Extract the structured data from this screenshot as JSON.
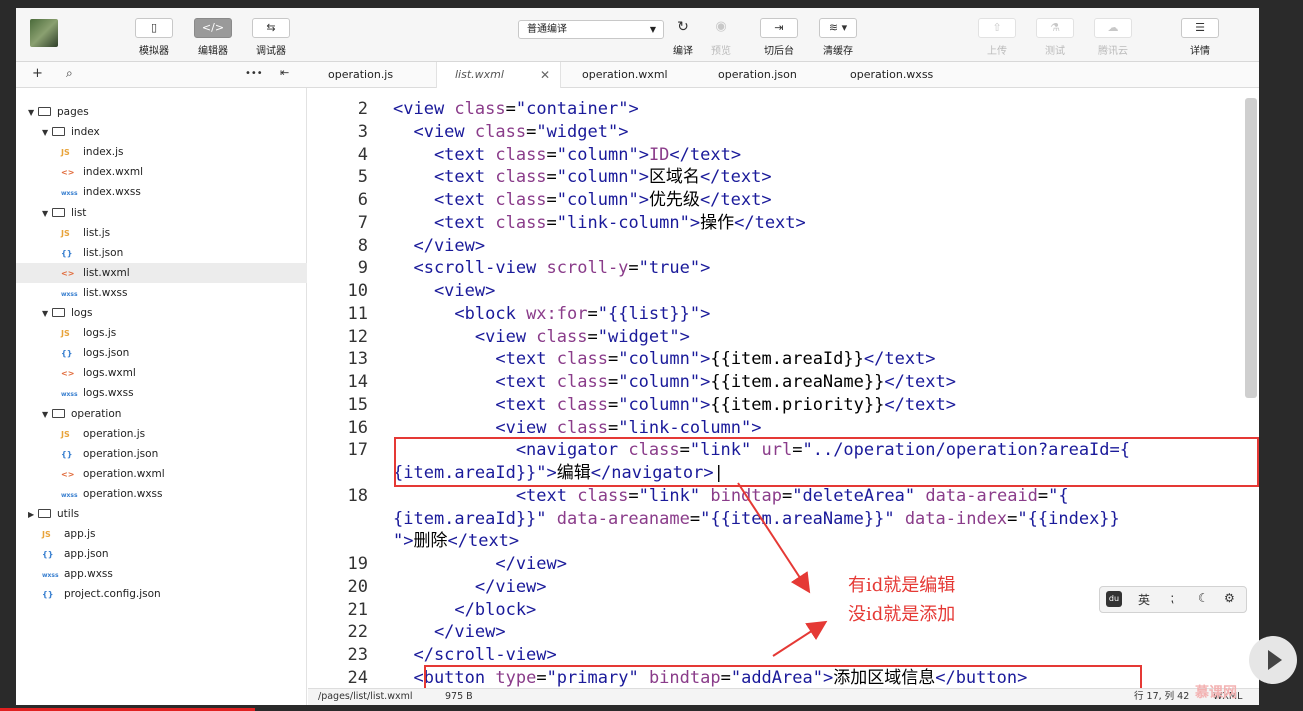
{
  "toolbar": {
    "simulator": "模拟器",
    "editor": "编辑器",
    "debugger": "调试器",
    "compile_mode": "普通编译",
    "compile": "编译",
    "preview": "预览",
    "background": "切后台",
    "clear_cache": "清缓存",
    "upload": "上传",
    "test": "测试",
    "tencent_cloud": "腾讯云",
    "details": "详情"
  },
  "tabs": [
    {
      "label": "operation.js"
    },
    {
      "label": "list.wxml"
    },
    {
      "label": "operation.wxml"
    },
    {
      "label": "operation.json"
    },
    {
      "label": "operation.wxss"
    }
  ],
  "tree": [
    {
      "label": "pages"
    },
    {
      "label": "index"
    },
    {
      "icon": "JS",
      "label": "index.js"
    },
    {
      "icon": "<>",
      "label": "index.wxml"
    },
    {
      "icon": "wxss",
      "label": "index.wxss"
    },
    {
      "label": "list"
    },
    {
      "icon": "JS",
      "label": "list.js"
    },
    {
      "icon": "{}",
      "label": "list.json"
    },
    {
      "icon": "<>",
      "label": "list.wxml"
    },
    {
      "icon": "wxss",
      "label": "list.wxss"
    },
    {
      "label": "logs"
    },
    {
      "icon": "JS",
      "label": "logs.js"
    },
    {
      "icon": "{}",
      "label": "logs.json"
    },
    {
      "icon": "<>",
      "label": "logs.wxml"
    },
    {
      "icon": "wxss",
      "label": "logs.wxss"
    },
    {
      "label": "operation"
    },
    {
      "icon": "JS",
      "label": "operation.js"
    },
    {
      "icon": "{}",
      "label": "operation.json"
    },
    {
      "icon": "<>",
      "label": "operation.wxml"
    },
    {
      "icon": "wxss",
      "label": "operation.wxss"
    },
    {
      "label": "utils"
    },
    {
      "icon": "JS",
      "label": "app.js"
    },
    {
      "icon": "{}",
      "label": "app.json"
    },
    {
      "icon": "wxss",
      "label": "app.wxss"
    },
    {
      "icon": "{}",
      "label": "project.config.json"
    }
  ],
  "code": {
    "numbers": [
      "2",
      "3",
      "4",
      "5",
      "6",
      "7",
      "8",
      "9",
      "10",
      "11",
      "12",
      "13",
      "14",
      "15",
      "16",
      "17",
      "18",
      "19",
      "20",
      "21",
      "22",
      "23",
      "24"
    ],
    "l2": [
      "<view ",
      "class",
      "=",
      "\"container\"",
      ">"
    ],
    "l3": [
      "  <view ",
      "class",
      "=",
      "\"widget\"",
      ">"
    ],
    "l4": [
      "    <text ",
      "class",
      "=",
      "\"column\"",
      ">",
      "ID",
      "</text>"
    ],
    "l5": [
      "    <text ",
      "class",
      "=",
      "\"column\"",
      ">",
      "区域名",
      "</text>"
    ],
    "l6": [
      "    <text ",
      "class",
      "=",
      "\"column\"",
      ">",
      "优先级",
      "</text>"
    ],
    "l7": [
      "    <text ",
      "class",
      "=",
      "\"link-column\"",
      ">",
      "操作",
      "</text>"
    ],
    "l8": [
      "  </view>"
    ],
    "l9": [
      "  <scroll-view ",
      "scroll-y",
      "=",
      "\"true\"",
      ">"
    ],
    "l10": [
      "    <view>"
    ],
    "l11": [
      "      <block ",
      "wx:for",
      "=",
      "\"{{list}}\"",
      ">"
    ],
    "l12": [
      "        <view ",
      "class",
      "=",
      "\"widget\"",
      ">"
    ],
    "l13": [
      "          <text ",
      "class",
      "=",
      "\"column\"",
      ">",
      "{{item.areaId}}",
      "</text>"
    ],
    "l14": [
      "          <text ",
      "class",
      "=",
      "\"column\"",
      ">",
      "{{item.areaName}}",
      "</text>"
    ],
    "l15": [
      "          <text ",
      "class",
      "=",
      "\"column\"",
      ">",
      "{{item.priority}}",
      "</text>"
    ],
    "l16": [
      "          <view ",
      "class",
      "=",
      "\"link-column\"",
      ">"
    ],
    "l17a": [
      "            <navigator ",
      "class",
      "=",
      "\"link\"",
      " ",
      "url",
      "=",
      "\"../operation/operation?areaId={"
    ],
    "l17b": [
      "{item.areaId}}\"",
      ">",
      "编辑",
      "</navigator>",
      "|"
    ],
    "l18a": [
      "            <text ",
      "class",
      "=",
      "\"link\"",
      " ",
      "bindtap",
      "=",
      "\"deleteArea\"",
      " ",
      "data-areaid",
      "=",
      "\"{"
    ],
    "l18b": [
      "{item.areaId}}\"",
      " ",
      "data-areaname",
      "=",
      "\"{{item.areaName}}\"",
      " ",
      "data-index",
      "=",
      "\"{{index}}"
    ],
    "l18c": [
      "\"",
      ">",
      "删除",
      "</text>"
    ],
    "l19": [
      "          </view>"
    ],
    "l20": [
      "        </view>"
    ],
    "l21": [
      "      </block>"
    ],
    "l22": [
      "    </view>"
    ],
    "l23": [
      "  </scroll-view>"
    ],
    "l24": [
      "  <button ",
      "type",
      "=",
      "\"primary\"",
      " ",
      "bindtap",
      "=",
      "\"addArea\"",
      ">",
      "添加区域信息",
      "</button>"
    ]
  },
  "annotation": {
    "line1": "有id就是编辑",
    "line2": "没id就是添加",
    "color": "#e53935"
  },
  "float_toolbar": {
    "lang": "英"
  },
  "status": {
    "path": "/pages/list/list.wxml",
    "size": "975 B",
    "cursor": "行 17, 列 42",
    "lang": "WXML"
  },
  "watermark": "慕课网"
}
